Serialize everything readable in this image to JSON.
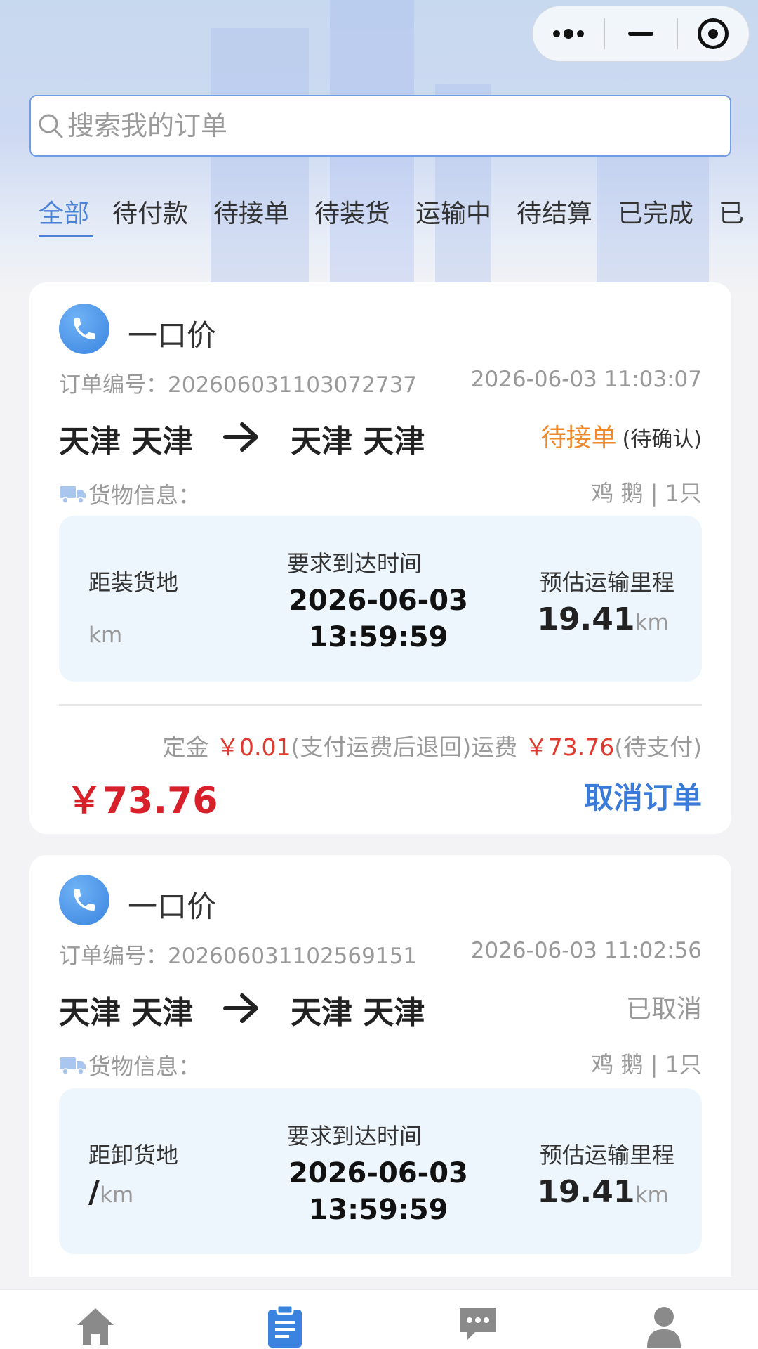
{
  "search": {
    "placeholder": "搜索我的订单"
  },
  "tabs": [
    {
      "label": "全部",
      "active": true
    },
    {
      "label": "待付款",
      "active": false
    },
    {
      "label": "待接单",
      "active": false
    },
    {
      "label": "待装货",
      "active": false
    },
    {
      "label": "运输中",
      "active": false
    },
    {
      "label": "待结算",
      "active": false
    },
    {
      "label": "已完成",
      "active": false
    },
    {
      "label": "已",
      "active": false
    }
  ],
  "orders": [
    {
      "price_type": "一口价",
      "order_no": "订单编号：20260603110307273​7",
      "order_time": "2026-06-03 11:03:07",
      "from": "天津 天津",
      "to": "天津 天津",
      "status": "待接单",
      "status_sub": "(待确认)",
      "cargo_label": "货物信息：",
      "cargo_value": "鸡 鹅 | 1只",
      "distance_label": "距装货地",
      "distance_value": "",
      "distance_unit": "km",
      "arrive_label": "要求到达时间",
      "arrive_date": "2026-06-03",
      "arrive_time": "13:59:59",
      "mileage_label": "预估运输里程",
      "mileage_value": "19.41",
      "mileage_unit": "km",
      "fee": {
        "deposit_label": "定金",
        "deposit_value": "￥0.01",
        "deposit_note": "(支付运费后退回)",
        "freight_label": "运费",
        "freight_value": "￥73.76",
        "freight_note": "(待支付)"
      },
      "total": "￥73.76",
      "action": "取消订单"
    },
    {
      "price_type": "一口价",
      "order_no": "订单编号：20260603110256915​1",
      "order_time": "2026-06-03 11:02:56",
      "from": "天津 天津",
      "to": "天津 天津",
      "status": "已取消",
      "cargo_label": "货物信息：",
      "cargo_value": "鸡 鹅 | 1只",
      "distance_label": "距卸货地",
      "distance_value": "/",
      "distance_unit": "km",
      "arrive_label": "要求到达时间",
      "arrive_date": "2026-06-03",
      "arrive_time": "13:59:59",
      "mileage_label": "预估运输里程",
      "mileage_value": "19.41",
      "mileage_unit": "km"
    }
  ],
  "icons": {
    "phone": "phone-icon",
    "truck": "truck-icon",
    "search": "search-icon",
    "home": "home-icon",
    "orders": "clipboard-icon",
    "messages": "chat-icon",
    "profile": "user-icon"
  },
  "colors": {
    "accent": "#4b82d8",
    "pending": "#f0892a",
    "price_red": "#d8202b",
    "muted": "#999999"
  }
}
